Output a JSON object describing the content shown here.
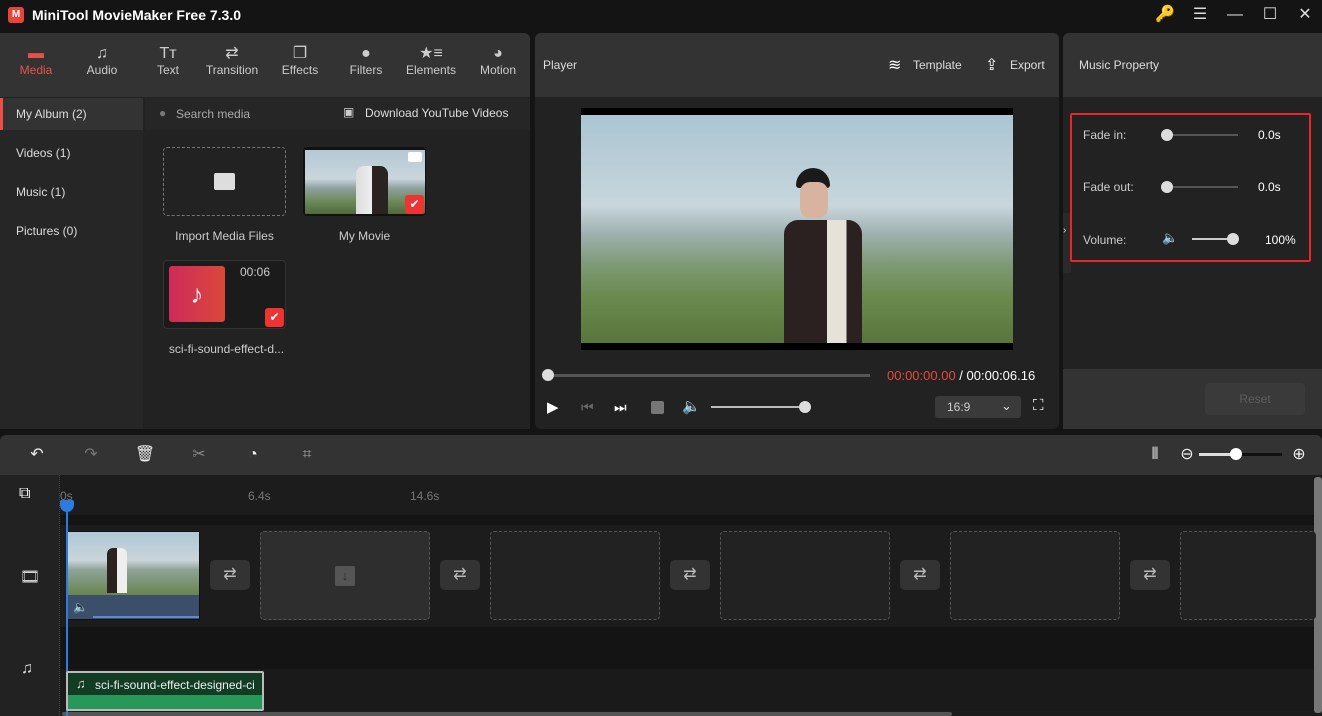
{
  "app": {
    "title": "MiniTool MovieMaker Free 7.3.0",
    "logo_glyph": "M"
  },
  "window_controls": {
    "key_icon": "🔑",
    "menu_icon": "☰",
    "minimize_icon": "—",
    "maximize_icon": "☐",
    "close_icon": "✕"
  },
  "toolbar": {
    "tabs": [
      {
        "label": "Media",
        "icon": "▬",
        "active": true
      },
      {
        "label": "Audio",
        "icon": "♫"
      },
      {
        "label": "Text",
        "icon": "Tт"
      },
      {
        "label": "Transition",
        "icon": "⇄"
      },
      {
        "label": "Effects",
        "icon": "❐"
      },
      {
        "label": "Filters",
        "icon": "●"
      },
      {
        "label": "Elements",
        "icon": "★≡"
      },
      {
        "label": "Motion",
        "icon": "◕"
      }
    ]
  },
  "sidebar": {
    "items": [
      {
        "label": "My Album (2)",
        "active": true
      },
      {
        "label": "Videos (1)"
      },
      {
        "label": "Music (1)"
      },
      {
        "label": "Pictures (0)"
      }
    ]
  },
  "media": {
    "search_placeholder": "Search media",
    "download_label": "Download YouTube Videos",
    "items": [
      {
        "label": "Import Media Files"
      },
      {
        "label": "My Movie"
      },
      {
        "label": "sci-fi-sound-effect-d...",
        "duration": "00:06"
      }
    ]
  },
  "player": {
    "title": "Player",
    "template_label": "Template",
    "export_label": "Export",
    "current_time": "00:00:00.00",
    "separator": " / ",
    "total_time": "00:00:06.16",
    "aspect_ratio": "16:9",
    "progress": 0,
    "volume": 1.0
  },
  "property": {
    "title": "Music Property",
    "fade_in_label": "Fade in:",
    "fade_in_value": "0.0s",
    "fade_out_label": "Fade out:",
    "fade_out_value": "0.0s",
    "volume_label": "Volume:",
    "volume_value": "100%",
    "reset_label": "Reset",
    "highlight_color": "#e8262a"
  },
  "timeline": {
    "ruler": [
      "0s",
      "6.4s",
      "14.6s"
    ],
    "audio_clip_label": "sci-fi-sound-effect-designed-ci",
    "playhead_color": "#2d7be0",
    "audio_clip_color": "#2a9a5a"
  }
}
